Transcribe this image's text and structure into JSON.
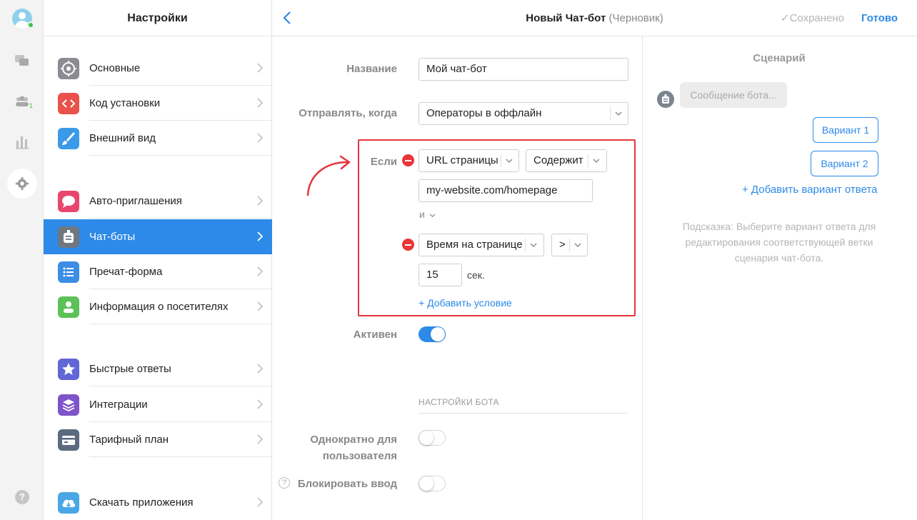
{
  "settings": {
    "title": "Настройки",
    "items": [
      {
        "label": "Основные",
        "color": "#8b8b91"
      },
      {
        "label": "Код установки",
        "color": "#e8524a"
      },
      {
        "label": "Внешний вид",
        "color": "#3b9ae8"
      },
      {
        "label": "Авто-приглашения",
        "color": "#e9466e"
      },
      {
        "label": "Чат-боты",
        "color": "#6f7880"
      },
      {
        "label": "Пречат-форма",
        "color": "#3b8de6"
      },
      {
        "label": "Информация о посетителях",
        "color": "#5cc157"
      },
      {
        "label": "Быстрые ответы",
        "color": "#6167d6"
      },
      {
        "label": "Интеграции",
        "color": "#7e54c9"
      },
      {
        "label": "Тарифный план",
        "color": "#5b6a7e"
      },
      {
        "label": "Скачать приложения",
        "color": "#4aa7e6"
      }
    ],
    "active_index": 4
  },
  "rail": {
    "contacts_badge": "1"
  },
  "header": {
    "title": "Новый Чат-бот",
    "draft": "(Черновик)",
    "saved": "✓Сохранено",
    "done": "Готово"
  },
  "form": {
    "name_label": "Название",
    "name_value": "Мой чат-бот",
    "send_when_label": "Отправлять, когда",
    "send_when_value": "Операторы в оффлайн",
    "if_label": "Если",
    "cond1_field": "URL страницы",
    "cond1_operator": "Содержит",
    "cond1_value": "my-website.com/homepage",
    "and_label": "и",
    "cond2_field": "Время на странице",
    "cond2_operator": ">",
    "cond2_value": "15",
    "cond2_unit": "сек.",
    "add_condition": "+ Добавить условие",
    "active_label": "Активен",
    "active": true,
    "bot_settings_title": "НАСТРОЙКИ БОТА",
    "once_label_line1": "Однократно для",
    "once_label_line2": "пользователя",
    "once": false,
    "block_input_label": "Блокировать ввод",
    "block_input": false
  },
  "scenario": {
    "title": "Сценарий",
    "bot_message_placeholder": "Сообщение бота...",
    "variant1": "Вариант 1",
    "variant2": "Вариант 2",
    "add_variant": "+ Добавить вариант ответа",
    "hint_line1": "Подсказка: Выберите вариант ответа для",
    "hint_line2": "редактирования соответствующей ветки",
    "hint_line3": "сценария чат-бота."
  },
  "colors": {
    "accent": "#2d8ae8",
    "highlight_border": "#e5353d",
    "remove": "#e8363a"
  }
}
